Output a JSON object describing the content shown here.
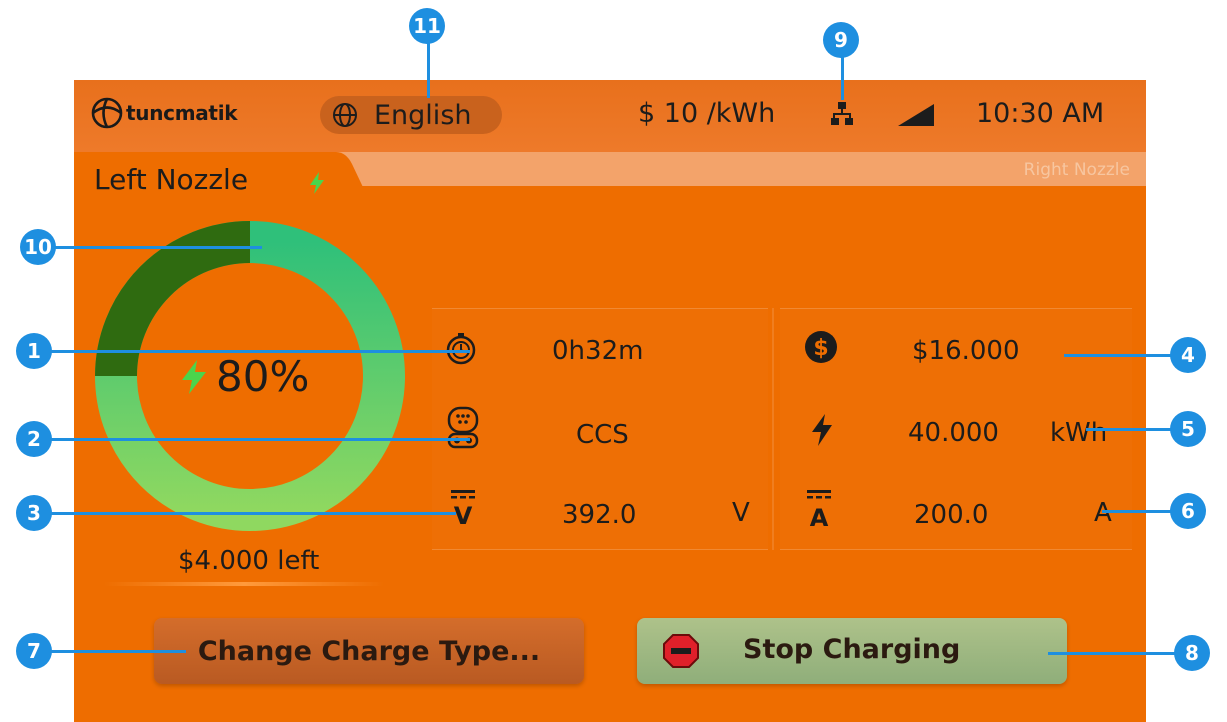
{
  "topbar": {
    "brand": "tuncmatik",
    "language": "English",
    "price": "$ 10 /kWh",
    "time": "10:30 AM",
    "icons": [
      "globe-icon",
      "network-icon",
      "signal-icon"
    ]
  },
  "tabs": {
    "left": "Left Nozzle",
    "right": "Right Nozzle"
  },
  "gauge": {
    "percent_label": "80%",
    "percent": 80,
    "dark_segment_percent": 25,
    "remaining": "$4.000 left"
  },
  "stats": {
    "duration": "0h32m",
    "connector": "CCS",
    "voltage": "392.0",
    "voltage_unit": "V",
    "cost": "$16.000",
    "energy": "40.000",
    "energy_unit": "kWh",
    "current": "200.0",
    "current_unit": "A"
  },
  "buttons": {
    "change": "Change Charge Type...",
    "stop": "Stop Charging"
  },
  "callouts": [
    "1",
    "2",
    "3",
    "4",
    "5",
    "6",
    "7",
    "8",
    "9",
    "10",
    "11"
  ],
  "colors": {
    "screen_bg": "#ee6d00",
    "ring_light": "#7fd36a",
    "ring_teal": "#2fc07a",
    "ring_dark": "#2f6b10",
    "callout": "#1e8fe0",
    "stop_red": "#e0202a"
  }
}
